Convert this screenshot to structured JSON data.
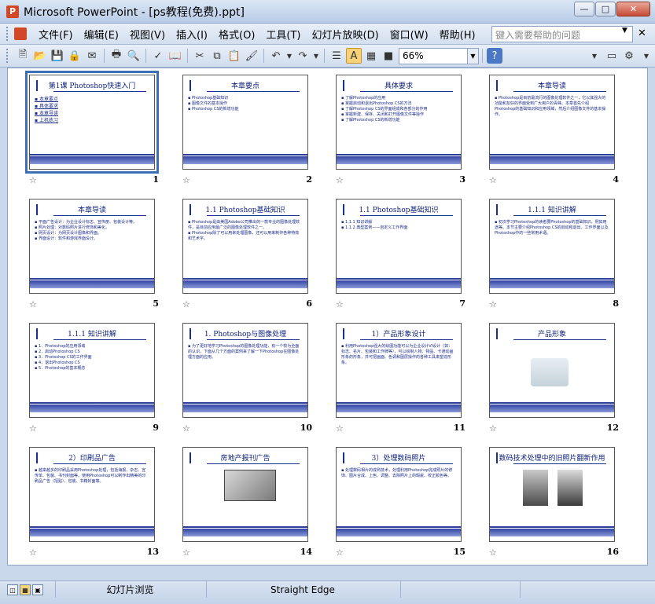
{
  "window": {
    "title": "Microsoft PowerPoint - [ps教程(免费).ppt]",
    "app_icon": "powerpoint-icon",
    "buttons": [
      "minimize",
      "maximize",
      "close"
    ]
  },
  "menu": {
    "items": [
      "文件(F)",
      "编辑(E)",
      "视图(V)",
      "插入(I)",
      "格式(O)",
      "工具(T)",
      "幻灯片放映(D)",
      "窗口(W)",
      "帮助(H)"
    ],
    "help_placeholder": "键入需要帮助的问题"
  },
  "toolbar": {
    "zoom": "66%"
  },
  "slides": [
    {
      "num": "1",
      "title": "第1课  Photoshop快速入门",
      "body": [
        "▪ 本章要点",
        "▪ 具体要求",
        "▪ 本章导读",
        "▪ 上机练习"
      ],
      "selected": true
    },
    {
      "num": "2",
      "title": "本章要点",
      "body": [
        "▪ Photoshop基础知识",
        "▪ 图像文件的基本操作",
        "▪ Photoshop CS的新增功能"
      ]
    },
    {
      "num": "3",
      "title": "具体要求",
      "body": [
        "▪ 了解Photoshop的应用",
        "▪ 掌握启动和退出Photoshop CS的方法",
        "▪ 了解Photoshop CS的界面组成和各部分的作用",
        "▪ 掌握新建、保存、关闭和打开图像文件等操作",
        "▪ 了解Photoshop CS的新增功能"
      ]
    },
    {
      "num": "4",
      "title": "本章导读",
      "body": [
        "▪ Photoshop是目前最流行的图像处理软件之一，它以其强大的功能和友好的界面受到广大用户的青睐。本章首先介绍Photoshop的基础知识和应用领域，然后介绍图像文件的基本操作。"
      ]
    },
    {
      "num": "5",
      "title": "本章导读",
      "body": [
        "▪ 平面广告设计：为企业设计标志、宣传册、包装设计等。",
        "▪ 照片处理：对数码照片进行修饰和美化。",
        "▪ 网页设计：为网页设计图像和界面。",
        "▪ 界面设计：软件和游戏界面设计。"
      ]
    },
    {
      "num": "6",
      "title": "1.1  Photoshop基础知识",
      "body": [
        "▪ Photoshop是由美国Adobe公司推出的一款专业的图像处理软件，是目前应用最广泛的图像处理软件之一。",
        "▪ Photoshop除了可以用来处理图像，还可以用来制作各种特效和艺术字。"
      ]
    },
    {
      "num": "7",
      "title": "1.1  Photoshop基础知识",
      "body": [
        "▪ 1.1.1  知识讲解",
        "▪ 1.1.2  典型案例——自定义工作界面"
      ]
    },
    {
      "num": "8",
      "title": "1.1.1  知识讲解",
      "body": [
        "▪ 初次学习Photoshop的读者要Photoshop的基础知识，例如用途等。本节主要介绍Photoshop CS的启动和退出、工作界面以及Photoshop中的一些常用术语。"
      ]
    },
    {
      "num": "9",
      "title": "1.1.1  知识讲解",
      "body": [
        "▪ 1．Photoshop的应用领域",
        "▪ 2．启动Photoshop CS",
        "▪ 3．Photoshop CS的工作界面",
        "▪ 4．退出Photoshop CS",
        "▪ 5．Photoshop的基本概念"
      ]
    },
    {
      "num": "10",
      "title": "1. Photoshop与图像处理",
      "body": [
        "▪ 为了更好地学习Photoshop的图像处理功能，有一个较为全面的认识，下面从几个方面的案例来了解一下Photoshop在图像处理方面的应用。"
      ]
    },
    {
      "num": "11",
      "title": "1）产品形象设计",
      "body": [
        "▪ 利用Photoshop强大的绘图功能可以为企业设计VI设计（如：标志、名片、包装和工作牌等），可以绘制人物、物品、卡通动画形象的形象，并可把画面、色调和图层操作的各种工具来塑造形象。"
      ]
    },
    {
      "num": "12",
      "title": "产品形象",
      "body": [],
      "image": "evian"
    },
    {
      "num": "13",
      "title": "2）印刷品广告",
      "body": [
        "▪ 越来越多的印刷品采用Photoshop处理，包括海报、杂志、宣传单、包装、书刊封面等。使用Photoshop可以制作出精美的印刷品广告（招贴），包装、书籍封面等。"
      ]
    },
    {
      "num": "14",
      "title": "房地产报刊广告",
      "body": [],
      "image": "ad"
    },
    {
      "num": "15",
      "title": "3）处理数码照片",
      "body": [
        "▪ 处理数码相片的成熟技术，处理利用Photoshop完成照片的修饰、图片合成、上色、调整、去除照片上的瑕疵、校正颜色等。"
      ]
    },
    {
      "num": "16",
      "title": "数码技术处理中的旧照片翻新作用",
      "body": [],
      "image": "photos"
    }
  ],
  "status": {
    "view_name": "幻灯片浏览",
    "design": "Straight Edge"
  }
}
